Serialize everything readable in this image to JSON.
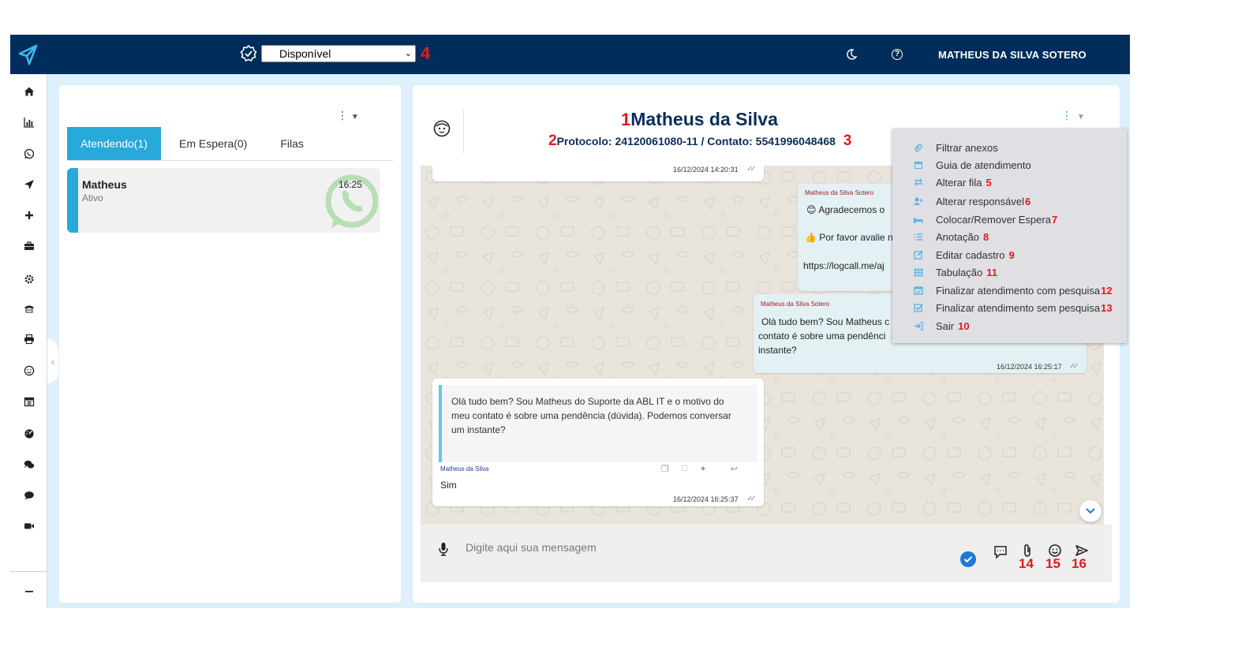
{
  "header": {
    "status_selected": "Disponível",
    "status_options": [
      "Disponível"
    ],
    "status_marker": "4",
    "user_name": "MATHEUS DA SILVA SOTERO",
    "theme_icon": "moon-icon",
    "help_icon": "help-icon"
  },
  "sidebar": {
    "icons": [
      "home-icon",
      "chart-icon",
      "whatsapp-icon",
      "send-icon",
      "plus-icon",
      "briefcase-icon",
      "gear-icon",
      "phone-icon",
      "print-icon",
      "smile-icon",
      "calendar-icon",
      "dashboard-icon",
      "comments-icon",
      "comment-icon",
      "video-icon",
      "minus-icon"
    ]
  },
  "chat_list": {
    "tabs": [
      {
        "label": "Atendendo(1)",
        "active": true
      },
      {
        "label": "Em Espera(0)",
        "active": false
      },
      {
        "label": "Filas",
        "active": false
      }
    ],
    "items": [
      {
        "name": "Matheus",
        "status": "Ativo",
        "time": "16:25",
        "channel": "whatsapp"
      }
    ]
  },
  "conversation": {
    "contact_name": "Matheus da Silva",
    "contact_name_marker": "1",
    "protocol_marker": "2",
    "protocol_info": "Protocolo: 24120061080-11 / Contato: 5541996048468",
    "protocol_info_marker": "3",
    "messages": [
      {
        "id": "m1",
        "time": "16/12/2024 14:20:31"
      },
      {
        "id": "m2",
        "sender": "Matheus da Silva Sotero",
        "emoji_1": "😊",
        "line1": "Agradecemos o",
        "emoji_2": "👍",
        "line2": "Por favor avalie n",
        "line3": "https://logcall.me/aj"
      },
      {
        "id": "m3",
        "sender": "Matheus da Silva Sotero",
        "text_lines": [
          "Olá tudo bem? Sou Matheus  c",
          "contato é sobre uma pendênci",
          "instante?"
        ],
        "time": "16/12/2024 16:25:17"
      },
      {
        "id": "m4",
        "quoted_lines": [
          " Olá tudo bem? Sou Matheus  do Suporte da ABL IT e o motivo do",
          "meu contato é sobre uma pendência (dúvida). Podemos conversar",
          "um instante?"
        ],
        "sender": "Matheus da Silva",
        "text": "Sim",
        "time": "16/12/2024 16:25:37"
      }
    ],
    "input_placeholder": "Digite aqui sua mensagem",
    "input_markers": [
      "14",
      "15",
      "16"
    ]
  },
  "context_menu": {
    "items": [
      {
        "label": "Filtrar anexos",
        "marker": "",
        "icon": "paperclip-icon"
      },
      {
        "label": "Guia de atendimento",
        "marker": "",
        "icon": "calendar-icon"
      },
      {
        "label": "Alterar fila",
        "marker": "5",
        "icon": "exchange-icon"
      },
      {
        "label": "Alterar responsável",
        "marker": "6",
        "icon": "user-plus-icon"
      },
      {
        "label": "Colocar/Remover Espera",
        "marker": "7",
        "icon": "bed-icon"
      },
      {
        "label": "Anotação",
        "marker": "8",
        "icon": "list-icon"
      },
      {
        "label": "Editar cadastro",
        "marker": "9",
        "icon": "edit-icon"
      },
      {
        "label": "Tabulação",
        "marker": "11",
        "icon": "table-icon"
      },
      {
        "label": "Finalizar atendimento com pesquisa",
        "marker": "12",
        "icon": "calendar-check-icon"
      },
      {
        "label": "Finalizar atendimento sem pesquisa",
        "marker": "13",
        "icon": "check-square-icon"
      },
      {
        "label": "Sair",
        "marker": "10",
        "icon": "sign-out-icon"
      }
    ]
  },
  "colors": {
    "topbar": "#002d5b",
    "accent": "#27a9d9",
    "annotation": "#e11b1b",
    "menu_icon": "#5ab4e5"
  }
}
